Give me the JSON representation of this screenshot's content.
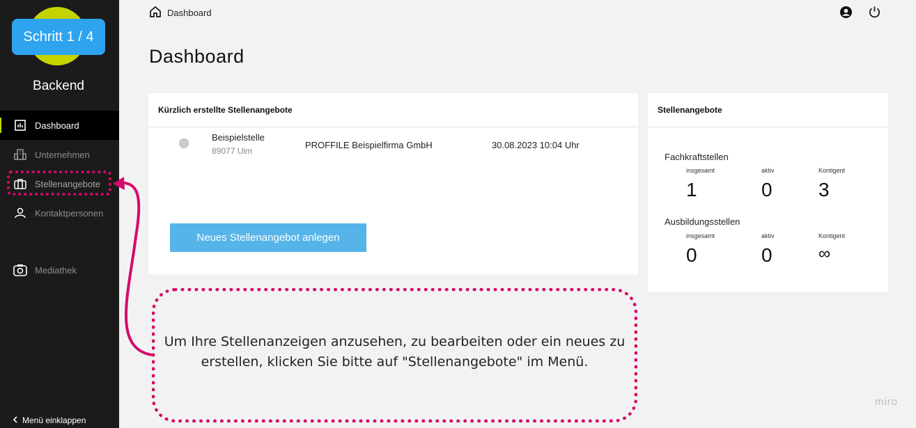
{
  "sidebar": {
    "step_badge": "Schritt 1 / 4",
    "brand": "Backend",
    "items": [
      {
        "label": "Dashboard",
        "icon": "chart-icon",
        "active": true
      },
      {
        "label": "Unternehmen",
        "icon": "building-icon"
      },
      {
        "label": "Stellenangebote",
        "icon": "briefcase-icon"
      },
      {
        "label": "Kontaktpersonen",
        "icon": "person-icon"
      },
      {
        "label": "Mediathek",
        "icon": "camera-icon"
      }
    ],
    "collapse_label": "Menü einklappen"
  },
  "topbar": {
    "breadcrumb": "Dashboard",
    "icons": [
      "account-icon",
      "power-icon"
    ]
  },
  "page": {
    "title": "Dashboard"
  },
  "recent_jobs": {
    "heading": "Kürzlich erstellte Stellenangebote",
    "rows": [
      {
        "title": "Beispielstelle",
        "city": "89077 Ulm",
        "company": "PROFFILE Beispielfirma GmbH",
        "date": "30.08.2023 10:04 Uhr"
      }
    ],
    "new_button": "Neues Stellenangebot anlegen"
  },
  "stats": {
    "heading": "Stellenangebote",
    "fachkraft": {
      "title": "Fachkraftstellen",
      "labels": [
        "insgesamt",
        "aktiv",
        "Kontigent"
      ],
      "values": [
        "1",
        "0",
        "3"
      ]
    },
    "ausbildung": {
      "title": "Ausbildungsstellen",
      "labels": [
        "insgesamt",
        "aktiv",
        "Kontigent"
      ],
      "values": [
        "0",
        "0",
        "∞"
      ]
    }
  },
  "callout": {
    "text": "Um Ihre Stellenanzeigen anzusehen, zu bearbeiten oder ein neues zu erstellen, klicken Sie bitte auf \"Stellenangebote\" im Menü."
  },
  "watermark": "miro",
  "colors": {
    "accent": "#c5d400",
    "badge": "#2ea3ee",
    "button": "#56b4e9",
    "highlight": "#d60a6a",
    "sidebar_bg": "#1b1b1b"
  }
}
